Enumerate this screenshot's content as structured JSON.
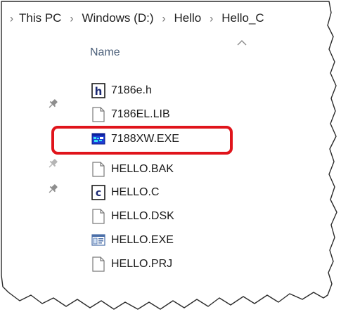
{
  "breadcrumb": {
    "items": [
      "This PC",
      "Windows (D:)",
      "Hello",
      "Hello_C"
    ]
  },
  "list_header": {
    "name_label": "Name",
    "sort_indicator": "chevron-up-icon"
  },
  "files": [
    {
      "name": "7186e.h",
      "icon": "header-file-icon"
    },
    {
      "name": "7186EL.LIB",
      "icon": "blank-file-icon"
    },
    {
      "name": "7188XW.EXE",
      "icon": "dos-app-icon",
      "highlighted": true
    },
    {
      "name": "HELLO.BAK",
      "icon": "blank-file-icon"
    },
    {
      "name": "HELLO.C",
      "icon": "c-source-file-icon"
    },
    {
      "name": "HELLO.DSK",
      "icon": "blank-file-icon"
    },
    {
      "name": "HELLO.EXE",
      "icon": "application-icon"
    },
    {
      "name": "HELLO.PRJ",
      "icon": "blank-file-icon"
    }
  ],
  "colors": {
    "highlight_border": "#e0141b",
    "header_text": "#4c607a"
  }
}
